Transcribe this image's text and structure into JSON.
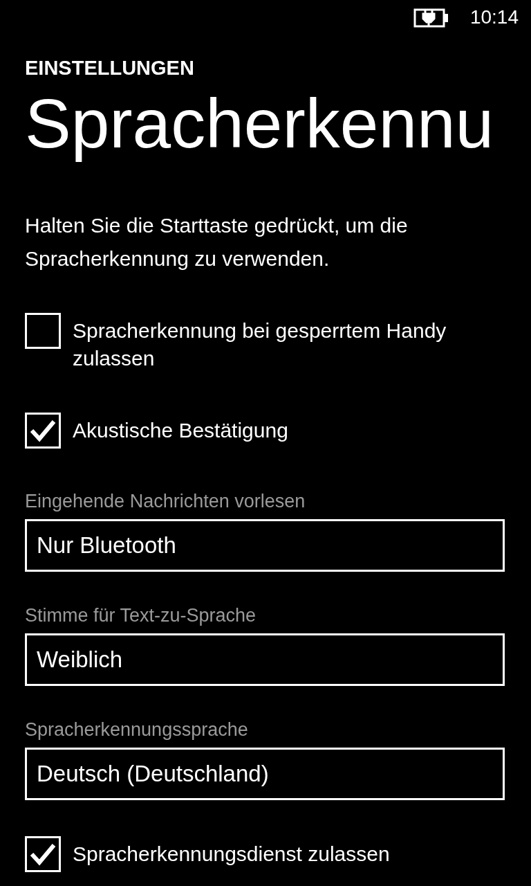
{
  "status_bar": {
    "time": "10:14"
  },
  "header": {
    "section": "EINSTELLUNGEN",
    "title": "Spracherkennu"
  },
  "description": "Halten Sie die Starttaste gedrückt, um die Spracherkennung zu verwenden.",
  "options": [
    {
      "kind": "checkbox",
      "label": "Spracherkennung bei gesperrtem Handy zulassen",
      "checked": false
    },
    {
      "kind": "checkbox",
      "label": "Akustische Bestätigung",
      "checked": true
    },
    {
      "kind": "picker",
      "label": "Eingehende Nachrichten vorlesen",
      "value": "Nur Bluetooth"
    },
    {
      "kind": "picker",
      "label": "Stimme für Text-zu-Sprache",
      "value": "Weiblich"
    },
    {
      "kind": "picker",
      "label": "Spracherkennungssprache",
      "value": "Deutsch (Deutschland)"
    },
    {
      "kind": "checkbox",
      "label": "Spracherkennungsdienst zulassen",
      "checked": true
    }
  ]
}
